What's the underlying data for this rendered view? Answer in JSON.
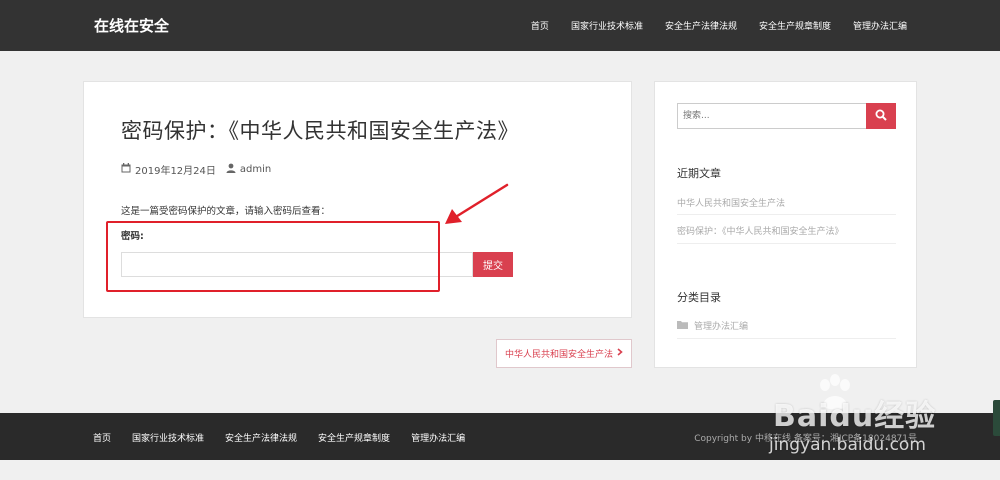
{
  "header": {
    "site_title": "在线在安全",
    "nav": [
      "首页",
      "国家行业技术标准",
      "安全生产法律法规",
      "安全生产规章制度",
      "管理办法汇编"
    ]
  },
  "post": {
    "title": "密码保护：《中华人民共和国安全生产法》",
    "date": "2019年12月24日",
    "author": "admin",
    "protect_note": "这是一篇受密码保护的文章，请输入密码后查看：",
    "password_label": "密码:",
    "password_value": "",
    "submit_label": "提交"
  },
  "post_nav": {
    "next_label": "中华人民共和国安全生产法",
    "next_icon": "chevron-right-icon"
  },
  "sidebar": {
    "search_placeholder": "搜索...",
    "search_icon": "search-icon",
    "recent_title": "近期文章",
    "recent_posts": [
      "中华人民共和国安全生产法",
      "密码保护：《中华人民共和国安全生产法》"
    ],
    "category_title": "分类目录",
    "categories": [
      "管理办法汇编"
    ]
  },
  "footer": {
    "nav": [
      "首页",
      "国家行业技术标准",
      "安全生产法律法规",
      "安全生产规章制度",
      "管理办法汇编"
    ],
    "copyright": "Copyright by 中移在线 备案号：湘ICP备18024871号"
  },
  "watermark": {
    "brand": "Baidu经验",
    "url": "jingyan.baidu.com"
  },
  "colors": {
    "accent": "#d9404f",
    "header_bg": "#333333",
    "footer_bg": "#2a2a2a",
    "page_bg": "#f0f0f0",
    "annotation": "#e0202a"
  }
}
